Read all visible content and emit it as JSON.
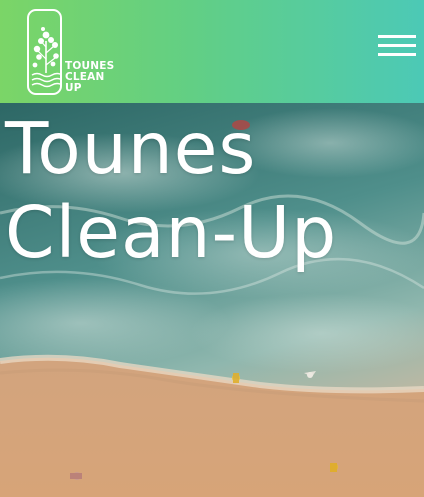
{
  "header": {
    "brand": {
      "line1": "TOUNES",
      "line2": "CLEAN",
      "line3": "UP",
      "emblem_icon": "tree-wave-emblem-icon"
    },
    "menu_icon": "hamburger-menu-icon",
    "gradient": [
      "#7bd567",
      "#4cc9b6"
    ]
  },
  "hero": {
    "title_line1": "Tounes",
    "title_line2": "Clean-Up",
    "background": "aerial-beach-photo"
  },
  "colors": {
    "text": "#ffffff",
    "sea": "#3f7f7e",
    "sand": "#d6a47c"
  }
}
